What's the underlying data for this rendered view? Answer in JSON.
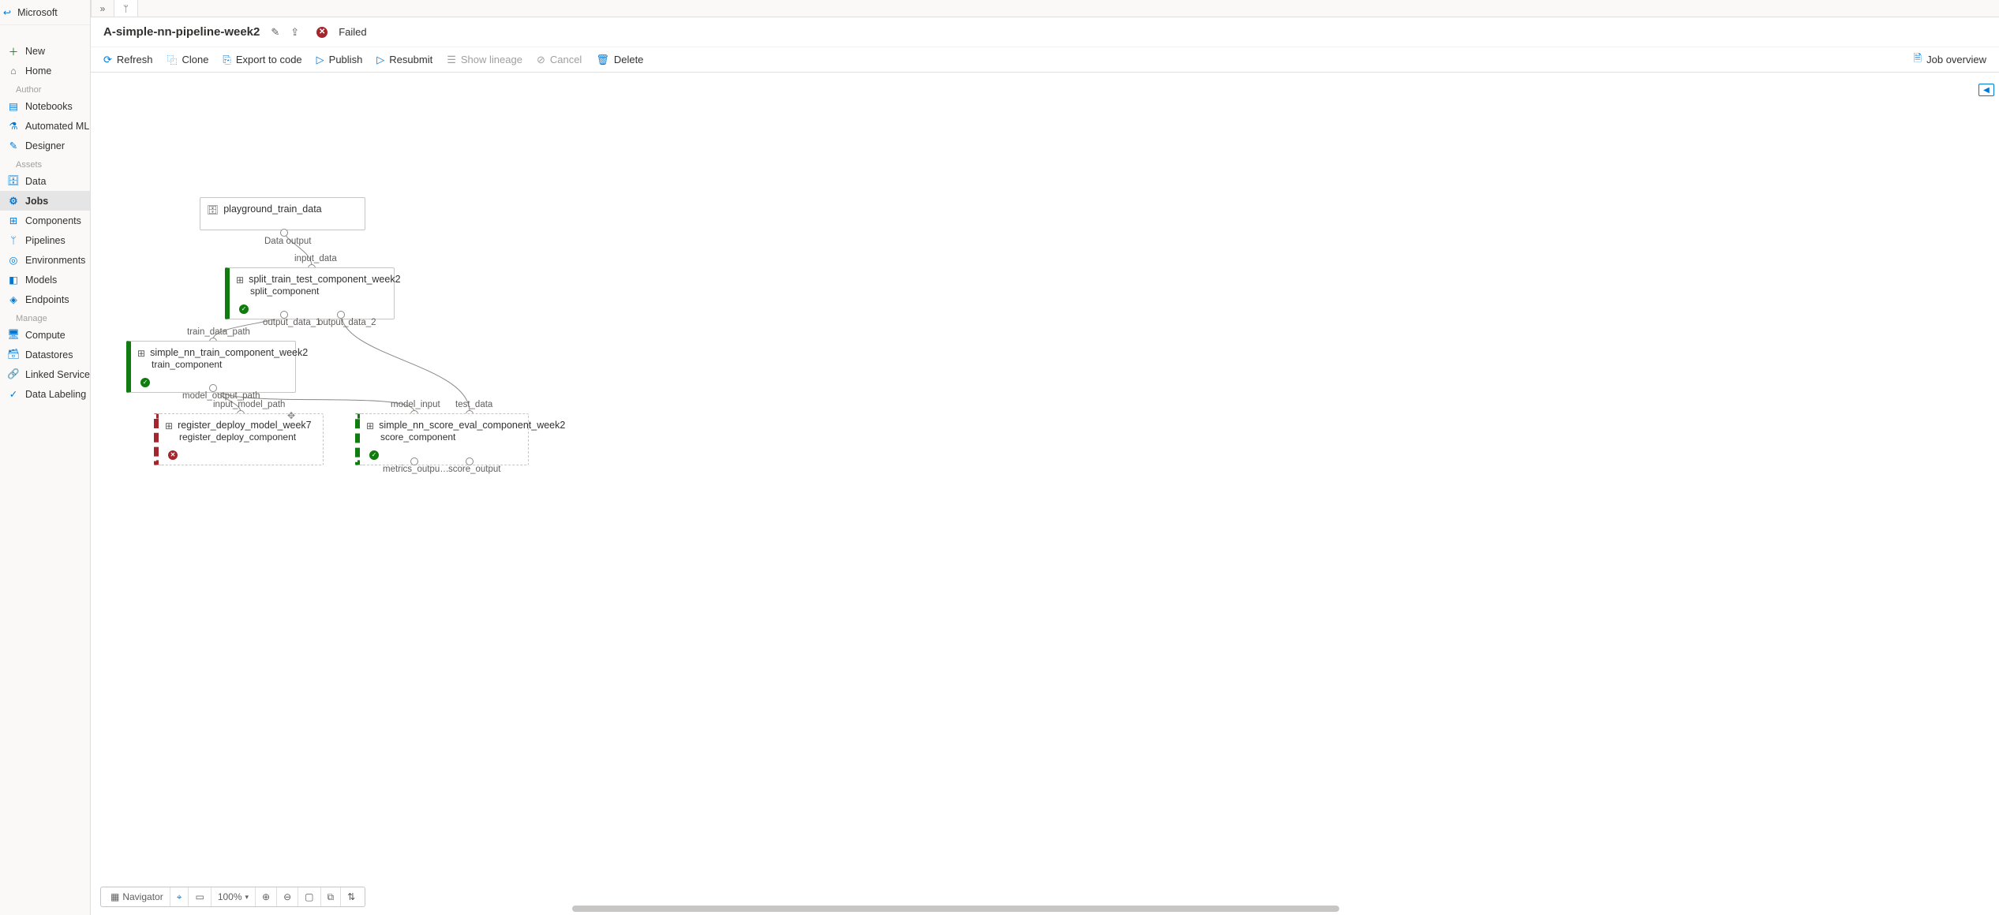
{
  "brand": "Microsoft",
  "sidebar": {
    "new": "New",
    "home": "Home",
    "sections": {
      "author": "Author",
      "assets": "Assets",
      "manage": "Manage"
    },
    "author_items": [
      "Notebooks",
      "Automated ML",
      "Designer"
    ],
    "assets_items": [
      "Data",
      "Jobs",
      "Components",
      "Pipelines",
      "Environments",
      "Models",
      "Endpoints"
    ],
    "manage_items": [
      "Compute",
      "Datastores",
      "Linked Services",
      "Data Labeling"
    ],
    "active": "Jobs"
  },
  "header": {
    "title": "A-simple-nn-pipeline-week2",
    "status": "Failed"
  },
  "toolbar": {
    "refresh": "Refresh",
    "clone": "Clone",
    "export": "Export to code",
    "publish": "Publish",
    "resubmit": "Resubmit",
    "lineage": "Show lineage",
    "cancel": "Cancel",
    "delete": "Delete",
    "overview": "Job overview"
  },
  "canvas": {
    "nodes": {
      "data": {
        "title": "playground_train_data",
        "out": "Data output"
      },
      "split": {
        "title": "split_train_test_component_week2",
        "sub": "split_component",
        "in": "input_data",
        "out1": "output_data_1",
        "out2": "output_data_2"
      },
      "train": {
        "title": "simple_nn_train_component_week2",
        "sub": "train_component",
        "in": "train_data_path",
        "out": "model_output_path"
      },
      "register": {
        "title": "register_deploy_model_week7",
        "sub": "register_deploy_component",
        "in": "input_model_path"
      },
      "score": {
        "title": "simple_nn_score_eval_component_week2",
        "sub": "score_component",
        "in1": "model_input",
        "in2": "test_data",
        "out1": "metrics_outpu…",
        "out2": "score_output"
      }
    }
  },
  "bottom": {
    "navigator": "Navigator",
    "zoom": "100%"
  }
}
